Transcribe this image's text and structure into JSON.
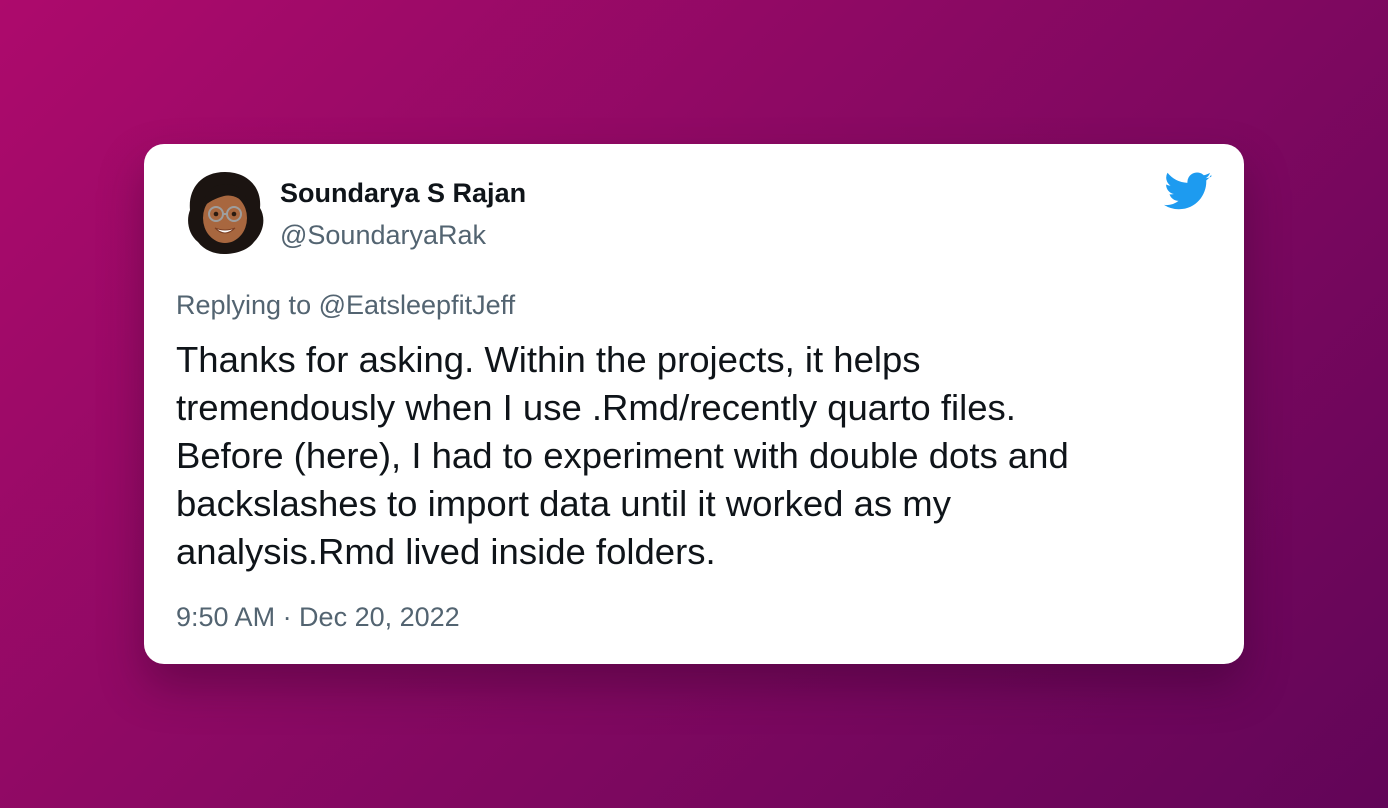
{
  "tweet": {
    "author": {
      "display_name": "Soundarya S Rajan",
      "handle": "@SoundaryaRak",
      "avatar_icon": "memoji-avatar-icon"
    },
    "platform_icon": "twitter-bird-icon",
    "reply_to": "Replying to @EatsleepfitJeff",
    "text_lines": [
      "Thanks for asking. Within the projects, it helps",
      "tremendously when I use .Rmd/recently quarto files.",
      "Before (here), I had to experiment with double dots and",
      "backslashes to import data until it worked as my",
      "analysis.Rmd lived inside folders."
    ],
    "timestamp": "9:50 AM · Dec 20, 2022"
  },
  "colors": {
    "background_start": "#ad0a6c",
    "background_end": "#620558",
    "card": "#ffffff",
    "primary_text": "#0f1419",
    "secondary_text": "#536471",
    "twitter_blue": "#1d9bf0"
  }
}
